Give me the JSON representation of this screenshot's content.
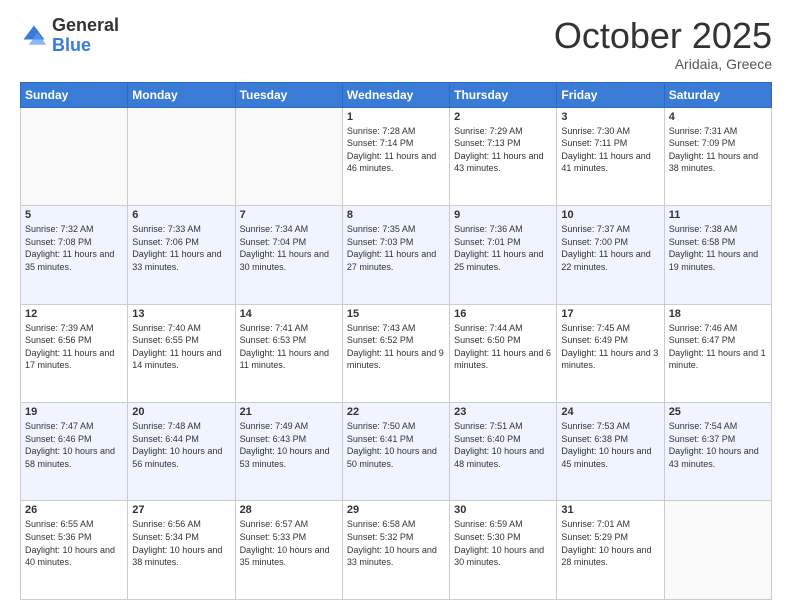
{
  "header": {
    "logo_general": "General",
    "logo_blue": "Blue",
    "month_title": "October 2025",
    "subtitle": "Aridaia, Greece"
  },
  "days_of_week": [
    "Sunday",
    "Monday",
    "Tuesday",
    "Wednesday",
    "Thursday",
    "Friday",
    "Saturday"
  ],
  "weeks": [
    [
      {
        "day": "",
        "sunrise": "",
        "sunset": "",
        "daylight": "",
        "empty": true
      },
      {
        "day": "",
        "sunrise": "",
        "sunset": "",
        "daylight": "",
        "empty": true
      },
      {
        "day": "",
        "sunrise": "",
        "sunset": "",
        "daylight": "",
        "empty": true
      },
      {
        "day": "1",
        "sunrise": "Sunrise: 7:28 AM",
        "sunset": "Sunset: 7:14 PM",
        "daylight": "Daylight: 11 hours and 46 minutes."
      },
      {
        "day": "2",
        "sunrise": "Sunrise: 7:29 AM",
        "sunset": "Sunset: 7:13 PM",
        "daylight": "Daylight: 11 hours and 43 minutes."
      },
      {
        "day": "3",
        "sunrise": "Sunrise: 7:30 AM",
        "sunset": "Sunset: 7:11 PM",
        "daylight": "Daylight: 11 hours and 41 minutes."
      },
      {
        "day": "4",
        "sunrise": "Sunrise: 7:31 AM",
        "sunset": "Sunset: 7:09 PM",
        "daylight": "Daylight: 11 hours and 38 minutes."
      }
    ],
    [
      {
        "day": "5",
        "sunrise": "Sunrise: 7:32 AM",
        "sunset": "Sunset: 7:08 PM",
        "daylight": "Daylight: 11 hours and 35 minutes."
      },
      {
        "day": "6",
        "sunrise": "Sunrise: 7:33 AM",
        "sunset": "Sunset: 7:06 PM",
        "daylight": "Daylight: 11 hours and 33 minutes."
      },
      {
        "day": "7",
        "sunrise": "Sunrise: 7:34 AM",
        "sunset": "Sunset: 7:04 PM",
        "daylight": "Daylight: 11 hours and 30 minutes."
      },
      {
        "day": "8",
        "sunrise": "Sunrise: 7:35 AM",
        "sunset": "Sunset: 7:03 PM",
        "daylight": "Daylight: 11 hours and 27 minutes."
      },
      {
        "day": "9",
        "sunrise": "Sunrise: 7:36 AM",
        "sunset": "Sunset: 7:01 PM",
        "daylight": "Daylight: 11 hours and 25 minutes."
      },
      {
        "day": "10",
        "sunrise": "Sunrise: 7:37 AM",
        "sunset": "Sunset: 7:00 PM",
        "daylight": "Daylight: 11 hours and 22 minutes."
      },
      {
        "day": "11",
        "sunrise": "Sunrise: 7:38 AM",
        "sunset": "Sunset: 6:58 PM",
        "daylight": "Daylight: 11 hours and 19 minutes."
      }
    ],
    [
      {
        "day": "12",
        "sunrise": "Sunrise: 7:39 AM",
        "sunset": "Sunset: 6:56 PM",
        "daylight": "Daylight: 11 hours and 17 minutes."
      },
      {
        "day": "13",
        "sunrise": "Sunrise: 7:40 AM",
        "sunset": "Sunset: 6:55 PM",
        "daylight": "Daylight: 11 hours and 14 minutes."
      },
      {
        "day": "14",
        "sunrise": "Sunrise: 7:41 AM",
        "sunset": "Sunset: 6:53 PM",
        "daylight": "Daylight: 11 hours and 11 minutes."
      },
      {
        "day": "15",
        "sunrise": "Sunrise: 7:43 AM",
        "sunset": "Sunset: 6:52 PM",
        "daylight": "Daylight: 11 hours and 9 minutes."
      },
      {
        "day": "16",
        "sunrise": "Sunrise: 7:44 AM",
        "sunset": "Sunset: 6:50 PM",
        "daylight": "Daylight: 11 hours and 6 minutes."
      },
      {
        "day": "17",
        "sunrise": "Sunrise: 7:45 AM",
        "sunset": "Sunset: 6:49 PM",
        "daylight": "Daylight: 11 hours and 3 minutes."
      },
      {
        "day": "18",
        "sunrise": "Sunrise: 7:46 AM",
        "sunset": "Sunset: 6:47 PM",
        "daylight": "Daylight: 11 hours and 1 minute."
      }
    ],
    [
      {
        "day": "19",
        "sunrise": "Sunrise: 7:47 AM",
        "sunset": "Sunset: 6:46 PM",
        "daylight": "Daylight: 10 hours and 58 minutes."
      },
      {
        "day": "20",
        "sunrise": "Sunrise: 7:48 AM",
        "sunset": "Sunset: 6:44 PM",
        "daylight": "Daylight: 10 hours and 56 minutes."
      },
      {
        "day": "21",
        "sunrise": "Sunrise: 7:49 AM",
        "sunset": "Sunset: 6:43 PM",
        "daylight": "Daylight: 10 hours and 53 minutes."
      },
      {
        "day": "22",
        "sunrise": "Sunrise: 7:50 AM",
        "sunset": "Sunset: 6:41 PM",
        "daylight": "Daylight: 10 hours and 50 minutes."
      },
      {
        "day": "23",
        "sunrise": "Sunrise: 7:51 AM",
        "sunset": "Sunset: 6:40 PM",
        "daylight": "Daylight: 10 hours and 48 minutes."
      },
      {
        "day": "24",
        "sunrise": "Sunrise: 7:53 AM",
        "sunset": "Sunset: 6:38 PM",
        "daylight": "Daylight: 10 hours and 45 minutes."
      },
      {
        "day": "25",
        "sunrise": "Sunrise: 7:54 AM",
        "sunset": "Sunset: 6:37 PM",
        "daylight": "Daylight: 10 hours and 43 minutes."
      }
    ],
    [
      {
        "day": "26",
        "sunrise": "Sunrise: 6:55 AM",
        "sunset": "Sunset: 5:36 PM",
        "daylight": "Daylight: 10 hours and 40 minutes."
      },
      {
        "day": "27",
        "sunrise": "Sunrise: 6:56 AM",
        "sunset": "Sunset: 5:34 PM",
        "daylight": "Daylight: 10 hours and 38 minutes."
      },
      {
        "day": "28",
        "sunrise": "Sunrise: 6:57 AM",
        "sunset": "Sunset: 5:33 PM",
        "daylight": "Daylight: 10 hours and 35 minutes."
      },
      {
        "day": "29",
        "sunrise": "Sunrise: 6:58 AM",
        "sunset": "Sunset: 5:32 PM",
        "daylight": "Daylight: 10 hours and 33 minutes."
      },
      {
        "day": "30",
        "sunrise": "Sunrise: 6:59 AM",
        "sunset": "Sunset: 5:30 PM",
        "daylight": "Daylight: 10 hours and 30 minutes."
      },
      {
        "day": "31",
        "sunrise": "Sunrise: 7:01 AM",
        "sunset": "Sunset: 5:29 PM",
        "daylight": "Daylight: 10 hours and 28 minutes."
      },
      {
        "day": "",
        "sunrise": "",
        "sunset": "",
        "daylight": "",
        "empty": true
      }
    ]
  ]
}
